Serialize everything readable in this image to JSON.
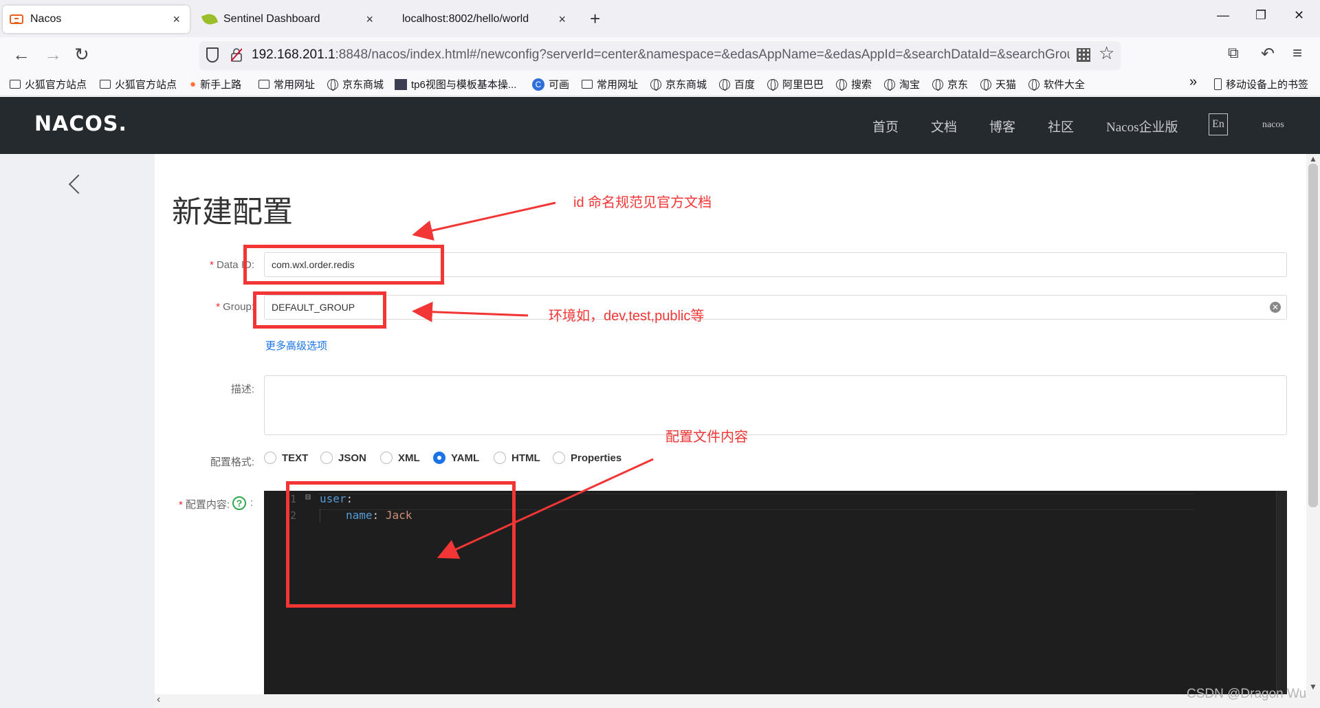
{
  "tabs": [
    {
      "label": "Nacos",
      "close": "×"
    },
    {
      "label": "Sentinel Dashboard",
      "close": "×"
    },
    {
      "label": "localhost:8002/hello/world",
      "close": "×"
    }
  ],
  "new_tab": "+",
  "window_controls": {
    "minimize": "—",
    "restore": "❐",
    "close": "✕"
  },
  "nav": {
    "back": "←",
    "forward": "→",
    "reload": "↻",
    "url_host": "192.168.201.1",
    "url_rest": ":8848/nacos/index.html#/newconfig?serverId=center&namespace=&edasAppName=&edasAppId=&searchDataId=&searchGroup",
    "star": "☆",
    "right_icons": {
      "crop": "⧉",
      "undo": "↶",
      "menu": "≡"
    }
  },
  "bookmarks": [
    {
      "label": "火狐官方站点",
      "icon": "folder"
    },
    {
      "label": "火狐官方站点",
      "icon": "folder"
    },
    {
      "label": "新手上路",
      "icon": "firefox"
    },
    {
      "label": "常用网址",
      "icon": "folder"
    },
    {
      "label": "京东商城",
      "icon": "globe"
    },
    {
      "label": "tp6视图与模板基本操...",
      "icon": "image"
    },
    {
      "label": "可画",
      "icon": "canva"
    },
    {
      "label": "常用网址",
      "icon": "folder"
    },
    {
      "label": "京东商城",
      "icon": "globe"
    },
    {
      "label": "百度",
      "icon": "globe"
    },
    {
      "label": "阿里巴巴",
      "icon": "globe"
    },
    {
      "label": "搜索",
      "icon": "globe"
    },
    {
      "label": "淘宝",
      "icon": "globe"
    },
    {
      "label": "京东",
      "icon": "globe"
    },
    {
      "label": "天猫",
      "icon": "globe"
    },
    {
      "label": "软件大全",
      "icon": "globe"
    }
  ],
  "bookmarks_overflow": "»",
  "mobile_bookmarks": "移动设备上的书签",
  "header": {
    "logo": "NACOS.",
    "nav_items": [
      "首页",
      "文档",
      "博客",
      "社区",
      "Nacos企业版"
    ],
    "lang": "En",
    "user": "nacos"
  },
  "page": {
    "title": "新建配置",
    "data_id_label": "Data ID:",
    "data_id_value": "com.wxl.order.redis",
    "group_label": "Group:",
    "group_value": "DEFAULT_GROUP",
    "advanced_link": "更多高级选项",
    "desc_label": "描述:",
    "format_label": "配置格式:",
    "formats": [
      "TEXT",
      "JSON",
      "XML",
      "YAML",
      "HTML",
      "Properties"
    ],
    "selected_format": "YAML",
    "content_label": "配置内容:",
    "help": "?",
    "colon": ":"
  },
  "editor": {
    "line_numbers": [
      "1",
      "2"
    ],
    "fold_marker": "⊟",
    "line1_key": "user",
    "line2_key": "name",
    "line2_value": "Jack",
    "colon": ":"
  },
  "annotations": {
    "id_note": "id 命名规范见官方文档",
    "group_note": "环境如，dev,test,public等",
    "content_note": "配置文件内容"
  },
  "watermark": "CSDN @Dragon   Wu",
  "colors": {
    "header_bg": "#252a2f",
    "accent": "#1a73e8",
    "annotation": "#f23535",
    "editor_bg": "#1e1e1e"
  }
}
